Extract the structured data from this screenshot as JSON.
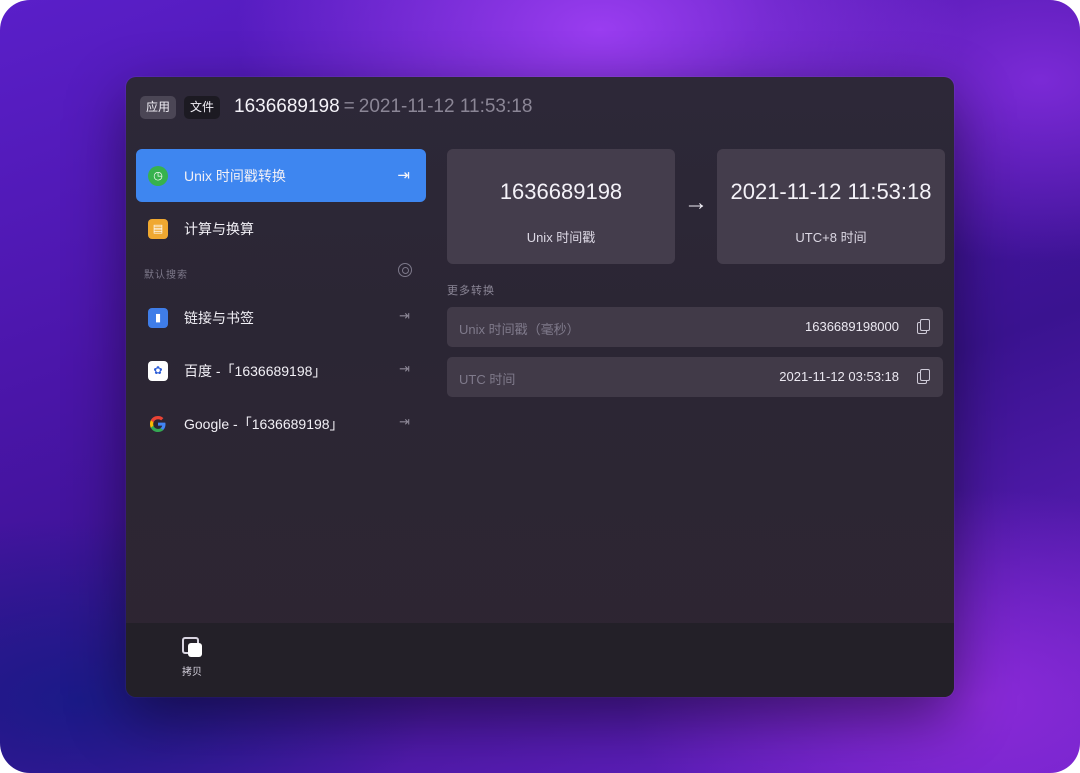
{
  "header": {
    "tab_app": "应用",
    "tab_file": "文件",
    "query": "1636689198",
    "equals": "=",
    "result": "2021-11-12 11:53:18"
  },
  "left": {
    "items_top": [
      {
        "label": "Unix 时间戳转换",
        "icon": "clock-icon",
        "enter": "⇥",
        "active": true
      },
      {
        "label": "计算与换算",
        "icon": "calculator-icon",
        "enter": "",
        "active": false
      }
    ],
    "section_title": "默认搜索",
    "items_search": [
      {
        "label": "链接与书签",
        "icon": "bookmark-icon",
        "enter": "⇥"
      },
      {
        "label": "百度 -「1636689198」",
        "icon": "baidu-icon",
        "enter": "⇥"
      },
      {
        "label": "Google -「1636689198」",
        "icon": "google-icon",
        "enter": "⇥"
      }
    ]
  },
  "main": {
    "card_left": {
      "value": "1636689198",
      "caption": "Unix 时间戳"
    },
    "arrow": "→",
    "card_right": {
      "value": "2021-11-12 11:53:18",
      "caption": "UTC+8 时间"
    },
    "more_title": "更多转换",
    "rows": [
      {
        "key": "Unix 时间戳（毫秒）",
        "value": "1636689198000"
      },
      {
        "key": "UTC 时间",
        "value": "2021-11-12 03:53:18"
      }
    ]
  },
  "footer": {
    "copy_label": "拷贝"
  },
  "colors": {
    "accent": "#3e86f0",
    "window_bg": "#2d2838",
    "card_bg": "#443d4c"
  }
}
